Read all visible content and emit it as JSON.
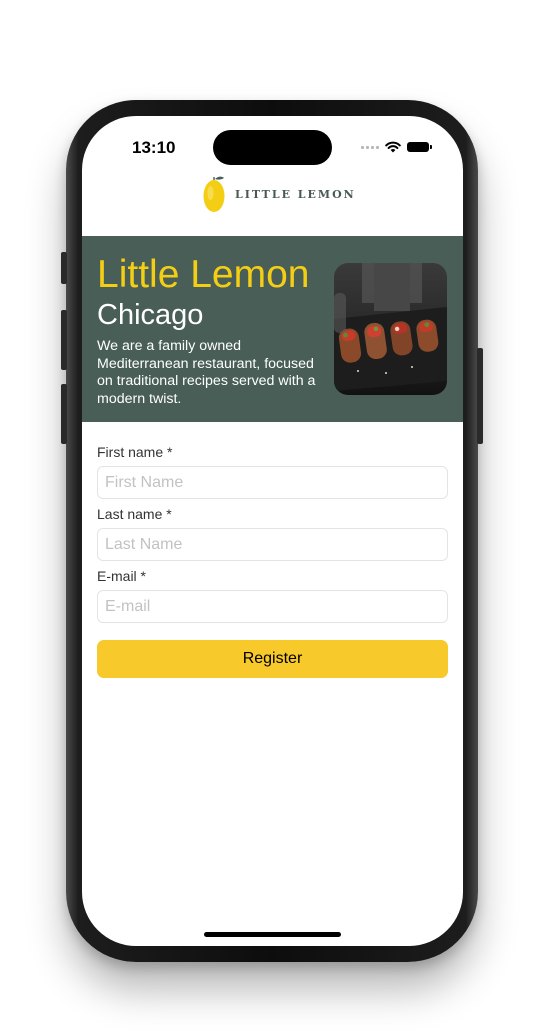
{
  "status_bar": {
    "time": "13:10"
  },
  "header": {
    "logo_text": "LITTLE LEMON"
  },
  "hero": {
    "title": "Little Lemon",
    "city": "Chicago",
    "description": "We are a family owned Mediterranean restaurant, focused on traditional recipes served with a modern twist."
  },
  "form": {
    "first_name": {
      "label": "First name *",
      "placeholder": "First Name",
      "value": ""
    },
    "last_name": {
      "label": "Last name *",
      "placeholder": "Last Name",
      "value": ""
    },
    "email": {
      "label": "E-mail *",
      "placeholder": "E-mail",
      "value": ""
    },
    "register_label": "Register"
  },
  "colors": {
    "brand_green": "#495e57",
    "brand_yellow": "#f4ce14",
    "button_yellow": "#f7c92a"
  },
  "icons": [
    "wifi-icon",
    "battery-icon",
    "cellular-signal-icon",
    "lemon-logo-icon"
  ]
}
